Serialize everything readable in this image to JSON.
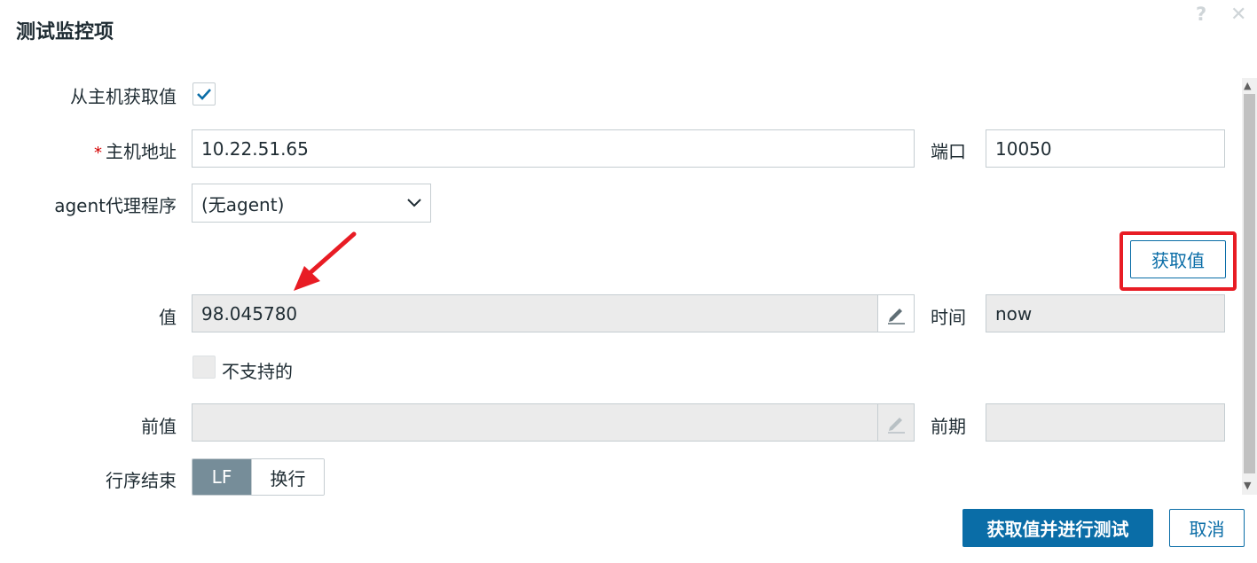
{
  "dialog": {
    "title": "测试监控项",
    "help_glyph": "?",
    "close_glyph": "✕"
  },
  "form": {
    "get_from_host": {
      "label": "从主机获取值",
      "checked": true
    },
    "host_address": {
      "required_mark": "*",
      "label": "主机地址",
      "value": "10.22.51.65"
    },
    "port": {
      "label": "端口",
      "value": "10050"
    },
    "agent_proxy": {
      "label": "agent代理程序",
      "selected": "(无agent)"
    },
    "get_value_button": "获取值",
    "value": {
      "label": "值",
      "value": "98.045780"
    },
    "time": {
      "label": "时间",
      "value": "now"
    },
    "not_supported": {
      "label": "不支持的",
      "checked": false
    },
    "prev_value": {
      "label": "前值",
      "value": ""
    },
    "prev_time": {
      "label": "前期",
      "value": ""
    },
    "eol": {
      "label": "行序结束",
      "options": [
        "LF",
        "换行"
      ],
      "selected": "LF"
    }
  },
  "footer": {
    "test_button": "获取值并进行测试",
    "cancel_button": "取消"
  },
  "colors": {
    "accent": "#0a6da7",
    "highlight_box": "#e81c24",
    "annotation_arrow": "#e81c24",
    "readonly_bg": "#ebebeb"
  }
}
